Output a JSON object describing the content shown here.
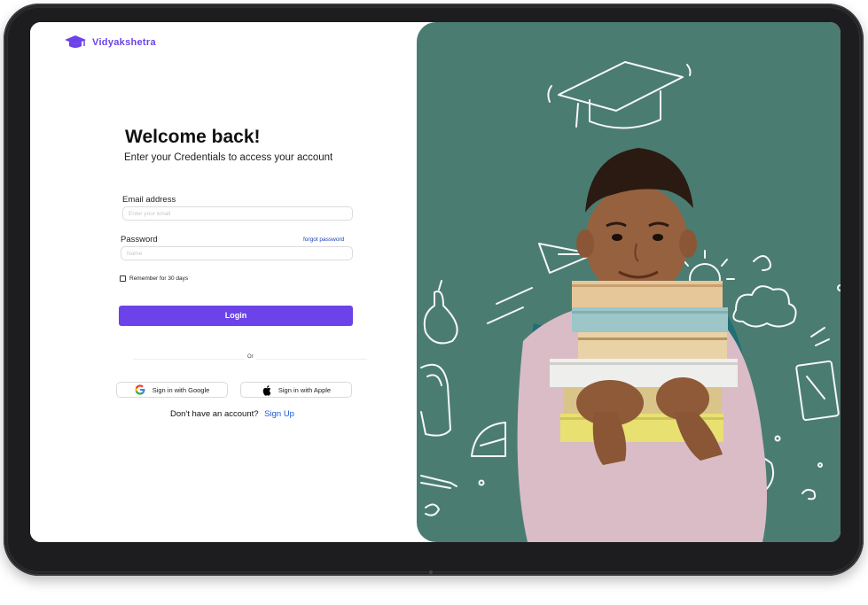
{
  "brand": {
    "name": "Vidyakshetra",
    "icon": "graduation-cap-icon",
    "color": "#6c43e8"
  },
  "login": {
    "title": "Welcome back!",
    "subtitle": "Enter your Credentials to access your account",
    "email_label": "Email address",
    "email_placeholder": "Enter your email",
    "password_label": "Password",
    "forgot_password": "forgot password",
    "password_placeholder": "Name",
    "remember_label": "Remember for 30 days",
    "login_button": "Login",
    "or_text": "Or",
    "google_button": "Sign in with Google",
    "apple_button": "Sign in with Apple",
    "signup_prompt": "Don't have an account?",
    "signup_link": "Sign Up"
  },
  "colors": {
    "accent": "#6c43e8",
    "hero_bg": "#4b7c72",
    "link": "#1a56d6"
  },
  "hero": {
    "image": "student-holding-books-illustration"
  }
}
